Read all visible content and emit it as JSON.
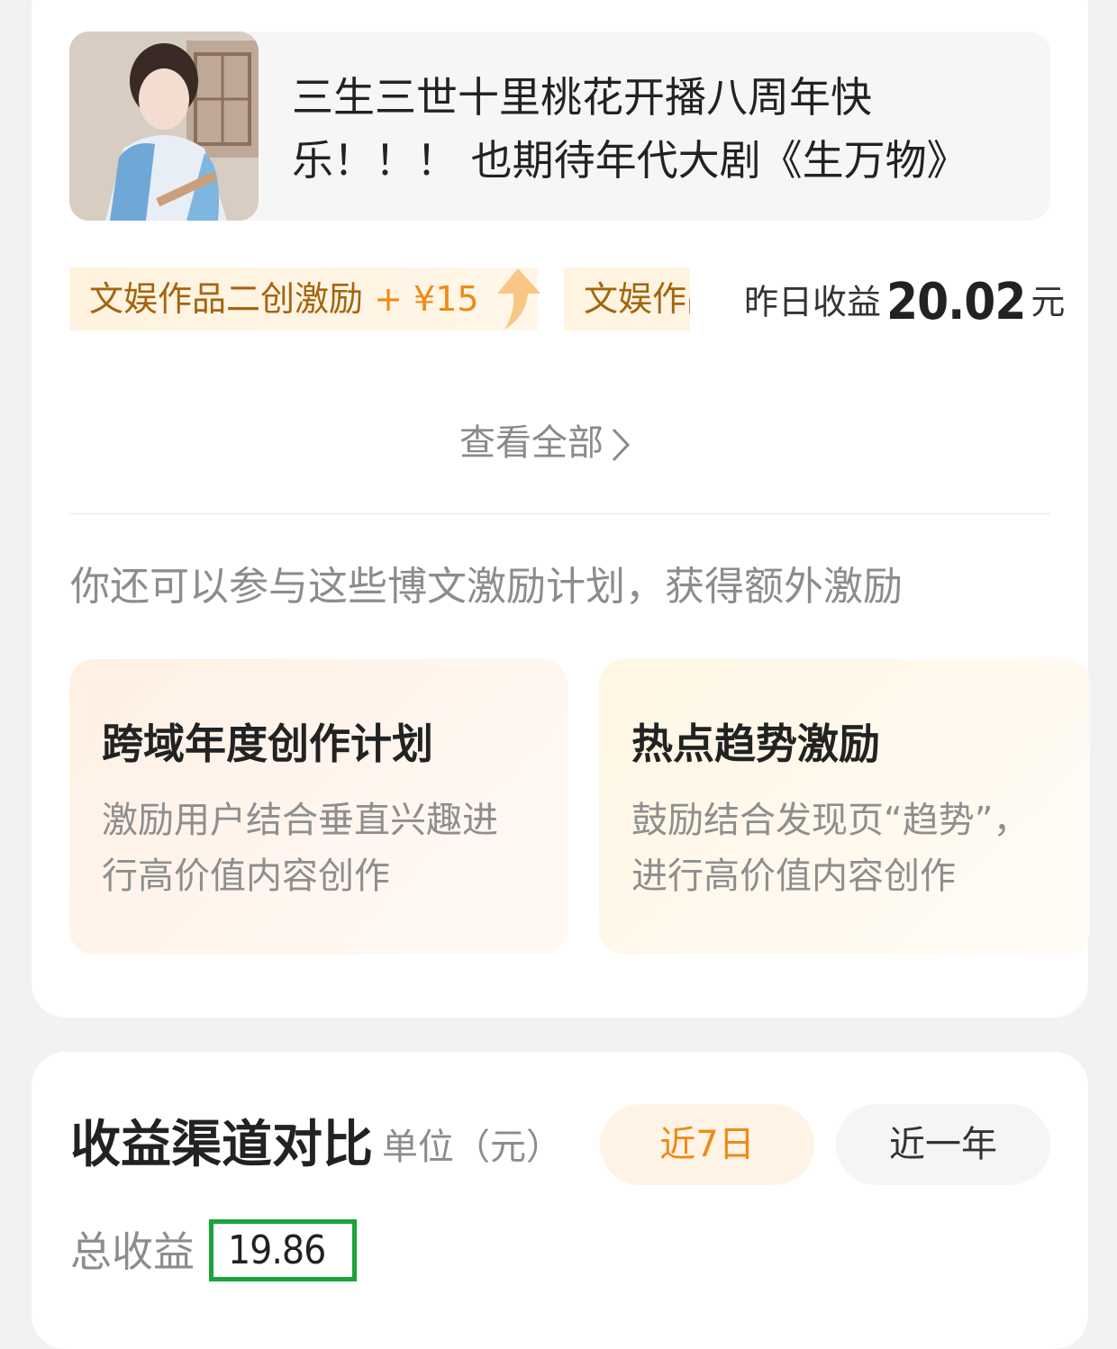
{
  "post": {
    "title": "三生三世十里桃花开播八周年快乐！！！ 也期待年代大剧《生万物》"
  },
  "tags": {
    "tag1_text": "文娱作品二创激励 ",
    "tag1_plus": "+ ¥15",
    "tag2_text": "文娱作品二创激励"
  },
  "yesterday": {
    "label": "昨日收益",
    "amount": "20.02",
    "unit": "元"
  },
  "view_all": "查看全部",
  "extra": {
    "title": "你还可以参与这些博文激励计划，获得额外激励",
    "plans": [
      {
        "name": "跨域年度创作计划",
        "desc": "激励用户结合垂直兴趣进行高价值内容创作"
      },
      {
        "name": "热点趋势激励",
        "desc": "鼓励结合发现页“趋势”，进行高价值内容创作"
      }
    ]
  },
  "channel": {
    "title": "收益渠道对比",
    "unit": "单位（元）",
    "tabs": [
      "近7日",
      "近一年"
    ],
    "total_label": "总收益",
    "total_value": "19.86"
  },
  "colors": {
    "accent": "#f08a14",
    "highlight_border": "#1aa53a"
  }
}
